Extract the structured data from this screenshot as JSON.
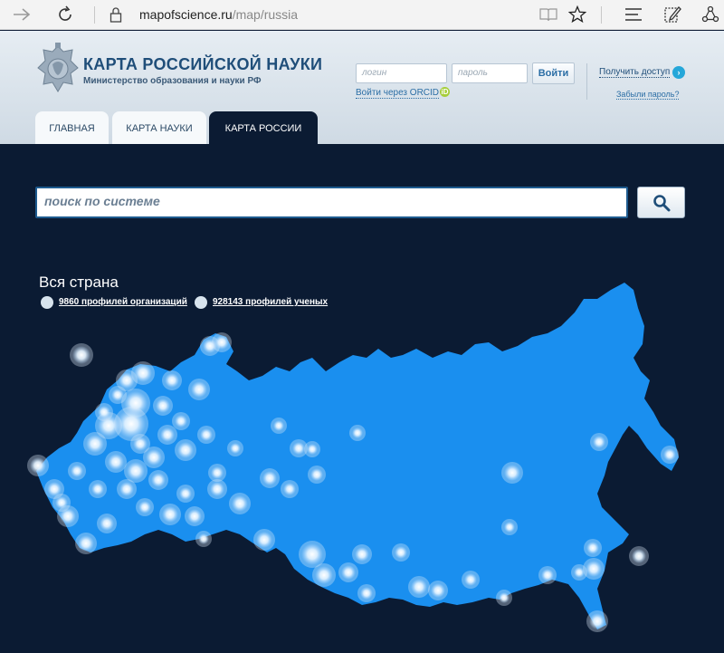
{
  "browser": {
    "url_host": "mapofscience.ru",
    "url_path": "/map/russia"
  },
  "header": {
    "title": "КАРТА РОССИЙСКОЙ НАУКИ",
    "subtitle": "Министерство образования и науки РФ",
    "login_placeholder": "логин",
    "password_placeholder": "пароль",
    "login_button": "Войти",
    "orcid_link": "Войти через ORCID",
    "orcid_badge": "iD",
    "access_link": "Получить доступ",
    "forgot_link": "Забыли пароль?"
  },
  "tabs": [
    {
      "label": "ГЛАВНАЯ",
      "active": false
    },
    {
      "label": "КАРТА НАУКИ",
      "active": false
    },
    {
      "label": "КАРТА РОССИИ",
      "active": true
    }
  ],
  "search": {
    "placeholder": "поиск по системе"
  },
  "region": {
    "title": "Вся страна",
    "org_profiles": "9860 профилей организаций",
    "scientist_profiles": "928143 профилей ученых"
  },
  "colors": {
    "map_fill": "#1a8fef",
    "background": "#0b1b33",
    "accent": "#25a7d9"
  },
  "map_points": [
    [
      90,
      392,
      10
    ],
    [
      42,
      514,
      9
    ],
    [
      60,
      540,
      8
    ],
    [
      75,
      570,
      9
    ],
    [
      95,
      600,
      9
    ],
    [
      118,
      578,
      8
    ],
    [
      140,
      420,
      9
    ],
    [
      158,
      412,
      10
    ],
    [
      150,
      445,
      13
    ],
    [
      145,
      468,
      16
    ],
    [
      120,
      470,
      12
    ],
    [
      105,
      490,
      10
    ],
    [
      128,
      510,
      9
    ],
    [
      150,
      520,
      10
    ],
    [
      170,
      505,
      9
    ],
    [
      185,
      480,
      8
    ],
    [
      205,
      497,
      9
    ],
    [
      220,
      430,
      9
    ],
    [
      232,
      382,
      8
    ],
    [
      245,
      378,
      8
    ],
    [
      190,
      420,
      8
    ],
    [
      175,
      530,
      8
    ],
    [
      188,
      568,
      9
    ],
    [
      215,
      570,
      8
    ],
    [
      240,
      540,
      8
    ],
    [
      265,
      556,
      9
    ],
    [
      298,
      528,
      8
    ],
    [
      320,
      540,
      7
    ],
    [
      292,
      596,
      9
    ],
    [
      330,
      495,
      7
    ],
    [
      350,
      524,
      7
    ],
    [
      345,
      612,
      12
    ],
    [
      358,
      635,
      10
    ],
    [
      385,
      632,
      8
    ],
    [
      400,
      612,
      8
    ],
    [
      405,
      655,
      7
    ],
    [
      443,
      610,
      7
    ],
    [
      463,
      648,
      9
    ],
    [
      484,
      652,
      8
    ],
    [
      520,
      640,
      7
    ],
    [
      557,
      660,
      6
    ],
    [
      566,
      522,
      9
    ],
    [
      563,
      582,
      6
    ],
    [
      605,
      635,
      7
    ],
    [
      655,
      605,
      7
    ],
    [
      656,
      628,
      9
    ],
    [
      640,
      632,
      6
    ],
    [
      662,
      488,
      7
    ],
    [
      740,
      502,
      7
    ],
    [
      706,
      614,
      8
    ],
    [
      660,
      686,
      9
    ],
    [
      395,
      478,
      6
    ],
    [
      308,
      470,
      6
    ],
    [
      345,
      496,
      6
    ],
    [
      228,
      480,
      7
    ],
    [
      260,
      495,
      6
    ],
    [
      85,
      520,
      7
    ],
    [
      108,
      540,
      7
    ],
    [
      68,
      555,
      7
    ],
    [
      140,
      540,
      8
    ],
    [
      160,
      560,
      7
    ],
    [
      205,
      545,
      7
    ],
    [
      240,
      522,
      7
    ],
    [
      225,
      595,
      6
    ],
    [
      130,
      436,
      7
    ],
    [
      180,
      448,
      8
    ],
    [
      200,
      465,
      7
    ],
    [
      155,
      490,
      8
    ],
    [
      115,
      455,
      7
    ]
  ]
}
